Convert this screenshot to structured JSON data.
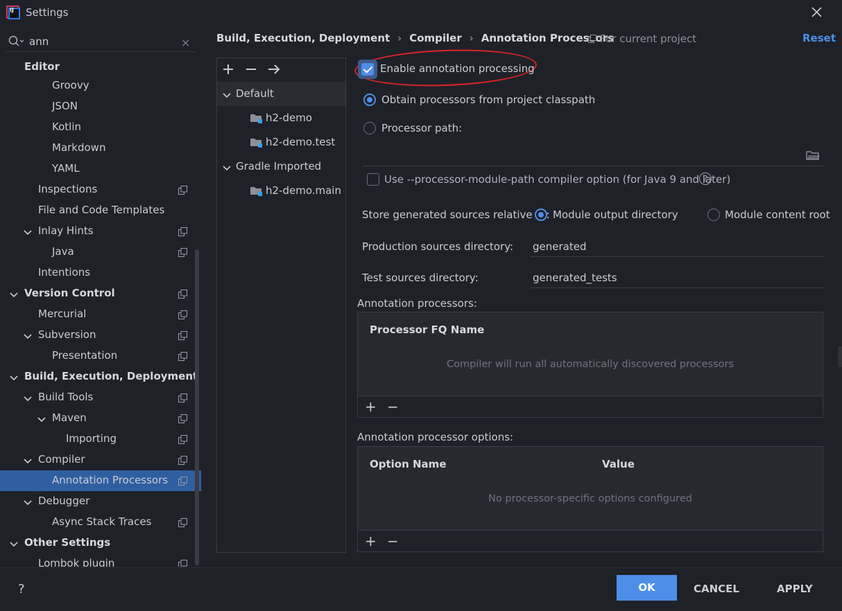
{
  "window": {
    "title": "Settings",
    "logo_text": "IJ"
  },
  "search": {
    "value": "ann",
    "clear": "×"
  },
  "tree": [
    {
      "label": "Editor",
      "bold": true,
      "indent": 0,
      "expand": "none"
    },
    {
      "label": "Groovy",
      "indent": 2,
      "expand": "none"
    },
    {
      "label": "JSON",
      "indent": 2,
      "expand": "none"
    },
    {
      "label": "Kotlin",
      "indent": 2,
      "expand": "none"
    },
    {
      "label": "Markdown",
      "indent": 2,
      "expand": "none"
    },
    {
      "label": "YAML",
      "indent": 2,
      "expand": "none"
    },
    {
      "label": "Inspections",
      "indent": 1,
      "expand": "none",
      "project": true
    },
    {
      "label": "File and Code Templates",
      "indent": 1,
      "expand": "none"
    },
    {
      "label": "Inlay Hints",
      "indent": 1,
      "expand": "open",
      "project": true
    },
    {
      "label": "Java",
      "indent": 2,
      "expand": "none",
      "project": true
    },
    {
      "label": "Intentions",
      "indent": 1,
      "expand": "none"
    },
    {
      "label": "Version Control",
      "bold": true,
      "indent": 0,
      "expand": "open",
      "project": true
    },
    {
      "label": "Mercurial",
      "indent": 1,
      "expand": "none",
      "project": true
    },
    {
      "label": "Subversion",
      "indent": 1,
      "expand": "open",
      "project": true
    },
    {
      "label": "Presentation",
      "indent": 2,
      "expand": "none",
      "project": true
    },
    {
      "label": "Build, Execution, Deployment",
      "bold": true,
      "indent": 0,
      "expand": "open"
    },
    {
      "label": "Build Tools",
      "indent": 1,
      "expand": "open",
      "project": true
    },
    {
      "label": "Maven",
      "indent": 2,
      "expand": "open",
      "project": true
    },
    {
      "label": "Importing",
      "indent": 3,
      "expand": "none",
      "project": true
    },
    {
      "label": "Compiler",
      "indent": 1,
      "expand": "open",
      "project": true
    },
    {
      "label": "Annotation Processors",
      "indent": 2,
      "expand": "none",
      "project": true,
      "selected": true
    },
    {
      "label": "Debugger",
      "indent": 1,
      "expand": "open"
    },
    {
      "label": "Async Stack Traces",
      "indent": 2,
      "expand": "none",
      "project": true
    },
    {
      "label": "Other Settings",
      "bold": true,
      "indent": 0,
      "expand": "open"
    },
    {
      "label": "Lombok plugin",
      "indent": 1,
      "expand": "none",
      "project": true
    }
  ],
  "breadcrumb": {
    "items": [
      "Build, Execution, Deployment",
      "Compiler",
      "Annotation Processors"
    ],
    "sep": "›"
  },
  "scope_label": "For current project",
  "reset_label": "Reset",
  "modules": {
    "toolbar": {
      "add": "+",
      "remove": "−",
      "move": "→"
    },
    "rows": [
      {
        "label": "Default",
        "kind": "group"
      },
      {
        "label": "h2-demo",
        "kind": "module"
      },
      {
        "label": "h2-demo.test",
        "kind": "module"
      },
      {
        "label": "Gradle Imported",
        "kind": "group"
      },
      {
        "label": "h2-demo.main",
        "kind": "module"
      }
    ]
  },
  "settings": {
    "enable_annotation": {
      "label": "Enable annotation processing",
      "checked": true
    },
    "obtain_classpath": {
      "label": "Obtain processors from project classpath",
      "selected": true
    },
    "processor_path": {
      "label": "Processor path:",
      "value": ""
    },
    "module_path_option": {
      "label": "Use --processor-module-path compiler option (for Java 9 and later)",
      "checked": false,
      "help": "?"
    },
    "store_generated": {
      "label": "Store generated sources relative to:",
      "options": [
        {
          "label": "Module output directory",
          "selected": true
        },
        {
          "label": "Module content root",
          "selected": false
        }
      ]
    },
    "production_dir": {
      "label": "Production sources directory:",
      "value": "generated"
    },
    "test_dir": {
      "label": "Test sources directory:",
      "value": "generated_tests"
    }
  },
  "processors_table": {
    "title": "Annotation processors:",
    "column": "Processor FQ Name",
    "empty": "Compiler will run all automatically discovered processors",
    "add": "+",
    "remove": "−"
  },
  "options_table": {
    "title": "Annotation processor options:",
    "columns": [
      "Option Name",
      "Value"
    ],
    "empty": "No processor-specific options configured",
    "add": "+",
    "remove": "−"
  },
  "buttons": {
    "help": "?",
    "ok": "OK",
    "cancel": "CANCEL",
    "apply": "APPLY"
  },
  "colors": {
    "accent": "#4e8ee8",
    "selection": "#2e5fa0",
    "highlight_ring": "#e02424",
    "background": "#1f2128"
  }
}
